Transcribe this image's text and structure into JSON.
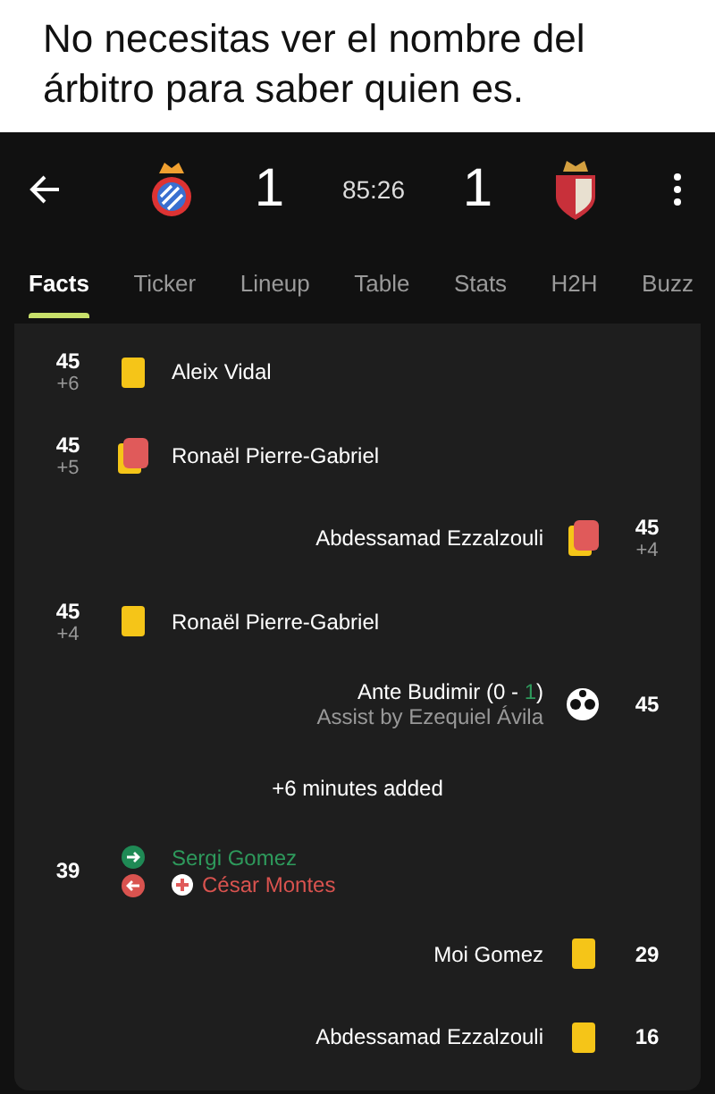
{
  "caption": "No necesitas ver el nombre del árbitro para saber quien es.",
  "match": {
    "home_score": "1",
    "clock": "85:26",
    "away_score": "1"
  },
  "tabs": [
    {
      "label": "Facts",
      "selected": true
    },
    {
      "label": "Ticker",
      "selected": false
    },
    {
      "label": "Lineup",
      "selected": false
    },
    {
      "label": "Table",
      "selected": false
    },
    {
      "label": "Stats",
      "selected": false
    },
    {
      "label": "H2H",
      "selected": false
    },
    {
      "label": "Buzz",
      "selected": false
    }
  ],
  "events": [
    {
      "kind": "yellow",
      "away": false,
      "minute": "45",
      "extra": "+6",
      "player": "Aleix Vidal"
    },
    {
      "kind": "red",
      "away": false,
      "minute": "45",
      "extra": "+5",
      "player": "Ronaël Pierre-Gabriel"
    },
    {
      "kind": "red",
      "away": true,
      "minute": "45",
      "extra": "+4",
      "player": "Abdessamad Ezzalzouli"
    },
    {
      "kind": "yellow",
      "away": false,
      "minute": "45",
      "extra": "+4",
      "player": "Ronaël Pierre-Gabriel"
    },
    {
      "kind": "goal",
      "away": true,
      "minute": "45",
      "player": "Ante Budimir (0 - ",
      "score_highlight": "1",
      "score_tail": ")",
      "assist": "Assist by Ezequiel Ávila"
    },
    {
      "kind": "added",
      "text": "+6 minutes added"
    },
    {
      "kind": "sub",
      "away": false,
      "minute": "39",
      "player_in": "Sergi Gomez",
      "player_out": "César Montes",
      "injured": true
    },
    {
      "kind": "yellow",
      "away": true,
      "minute": "29",
      "player": "Moi Gomez"
    },
    {
      "kind": "yellow",
      "away": true,
      "minute": "16",
      "player": "Abdessamad Ezzalzouli"
    }
  ]
}
